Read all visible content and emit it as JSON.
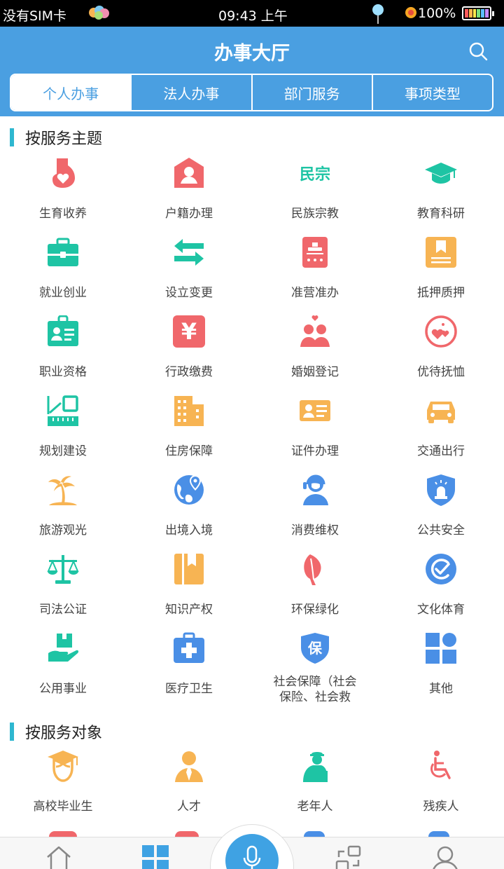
{
  "status_bar": {
    "carrier": "没有SIM卡",
    "time": "09:43 上午",
    "battery": "100%"
  },
  "header": {
    "title": "办事大厅",
    "tabs": [
      {
        "label": "个人办事",
        "active": true
      },
      {
        "label": "法人办事",
        "active": false
      },
      {
        "label": "部门服务",
        "active": false
      },
      {
        "label": "事项类型",
        "active": false
      }
    ]
  },
  "theme_section": {
    "title": "按服务主题",
    "items": [
      {
        "label": "生育收养",
        "icon": "pregnancy-icon",
        "color": "#f0676b"
      },
      {
        "label": "户籍办理",
        "icon": "household-register-icon",
        "color": "#f0676b"
      },
      {
        "label": "民族宗教",
        "icon": "ethnic-religion-icon",
        "color": "#1ec4a4",
        "glyph": "民宗"
      },
      {
        "label": "教育科研",
        "icon": "graduation-cap-icon",
        "color": "#1ec4a4"
      },
      {
        "label": "就业创业",
        "icon": "briefcase-icon",
        "color": "#1ec4a4"
      },
      {
        "label": "设立变更",
        "icon": "swap-arrows-icon",
        "color": "#1ec4a4"
      },
      {
        "label": "准营准办",
        "icon": "license-stamp-icon",
        "color": "#f0676b"
      },
      {
        "label": "抵押质押",
        "icon": "bookmark-doc-icon",
        "color": "#f7b453"
      },
      {
        "label": "职业资格",
        "icon": "id-badge-icon",
        "color": "#1ec4a4"
      },
      {
        "label": "行政缴费",
        "icon": "yuan-icon",
        "color": "#f0676b",
        "glyph": "¥"
      },
      {
        "label": "婚姻登记",
        "icon": "couple-icon",
        "color": "#f0676b"
      },
      {
        "label": "优待抚恤",
        "icon": "hearts-circle-icon",
        "color": "#f0676b"
      },
      {
        "label": "规划建设",
        "icon": "planning-ruler-icon",
        "color": "#1ec4a4"
      },
      {
        "label": "住房保障",
        "icon": "building-icon",
        "color": "#f7b453"
      },
      {
        "label": "证件办理",
        "icon": "id-card-icon",
        "color": "#f7b453"
      },
      {
        "label": "交通出行",
        "icon": "car-icon",
        "color": "#f7b453"
      },
      {
        "label": "旅游观光",
        "icon": "palm-tree-icon",
        "color": "#f7b453"
      },
      {
        "label": "出境入境",
        "icon": "globe-pin-icon",
        "color": "#4a8fe6"
      },
      {
        "label": "消费维权",
        "icon": "customer-service-icon",
        "color": "#4a8fe6"
      },
      {
        "label": "公共安全",
        "icon": "police-shield-icon",
        "color": "#4a8fe6"
      },
      {
        "label": "司法公证",
        "icon": "scales-icon",
        "color": "#1ec4a4"
      },
      {
        "label": "知识产权",
        "icon": "book-icon",
        "color": "#f7b453"
      },
      {
        "label": "环保绿化",
        "icon": "leaf-icon",
        "color": "#f0676b"
      },
      {
        "label": "文化体育",
        "icon": "check-circle-icon",
        "color": "#4a8fe6"
      },
      {
        "label": "公用事业",
        "icon": "hand-box-icon",
        "color": "#1ec4a4"
      },
      {
        "label": "医疗卫生",
        "icon": "medical-kit-icon",
        "color": "#4a8fe6"
      },
      {
        "label": "社会保障（社会保险、社会救",
        "icon": "social-security-shield-icon",
        "color": "#4a8fe6",
        "glyph": "保"
      },
      {
        "label": "其他",
        "icon": "grid-other-icon",
        "color": "#4a8fe6"
      }
    ]
  },
  "target_section": {
    "title": "按服务对象",
    "items": [
      {
        "label": "高校毕业生",
        "icon": "graduate-icon",
        "color": "#f7b453"
      },
      {
        "label": "人才",
        "icon": "talent-person-icon",
        "color": "#f7b453"
      },
      {
        "label": "老年人",
        "icon": "elderly-icon",
        "color": "#1ec4a4"
      },
      {
        "label": "残疾人",
        "icon": "wheelchair-icon",
        "color": "#f0676b"
      }
    ]
  },
  "bottom_nav": {
    "items": [
      {
        "icon": "home-icon"
      },
      {
        "icon": "apps-grid-icon",
        "active": true
      },
      {
        "icon": "microphone-icon"
      },
      {
        "icon": "swap-squares-icon"
      },
      {
        "icon": "user-icon"
      }
    ]
  }
}
